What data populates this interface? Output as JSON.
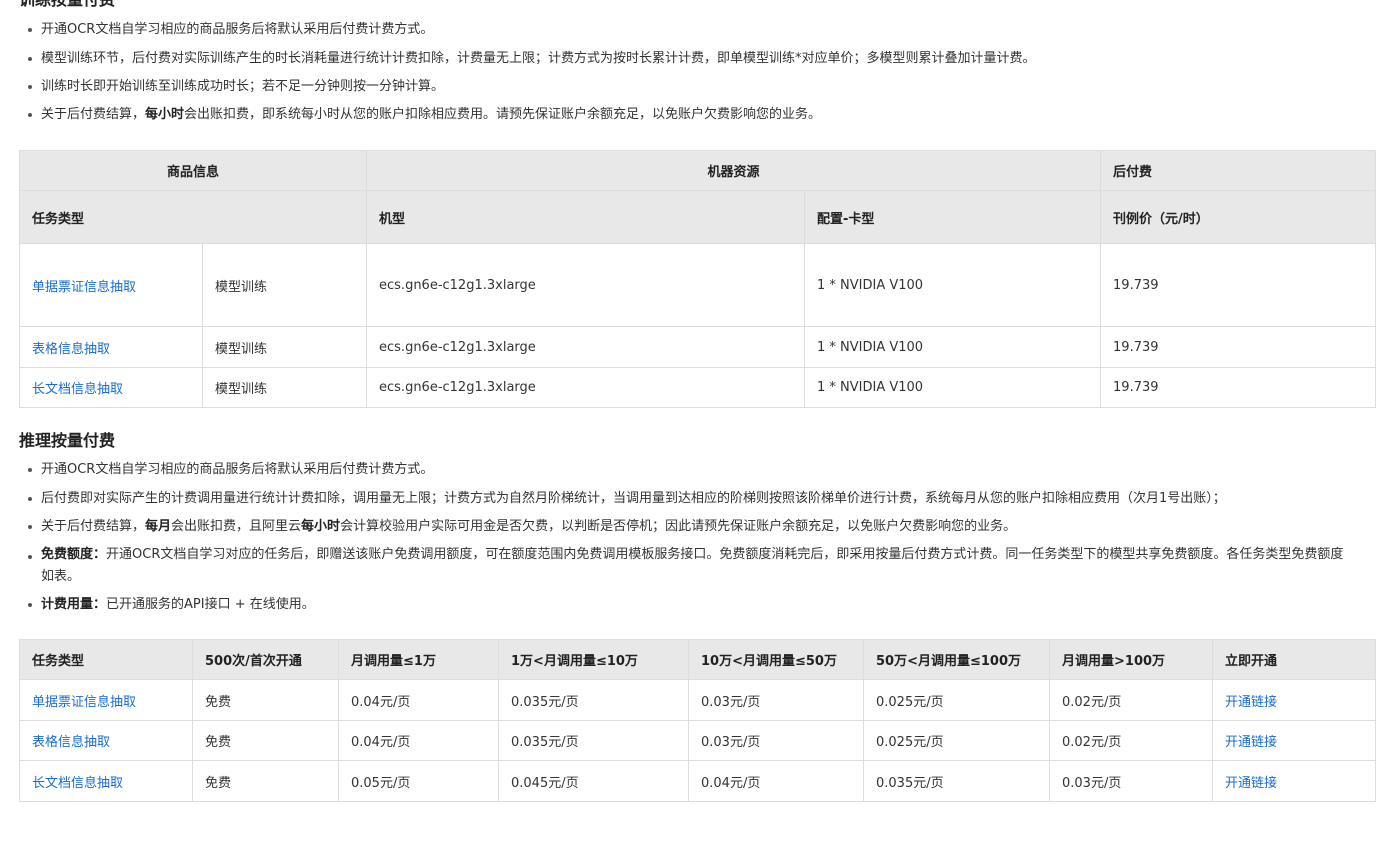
{
  "section1": {
    "title": "训练按量付费",
    "bullets": [
      {
        "pre": "开通OCR文档自学习相应的商品服务后将默认采用后付费计费方式。"
      },
      {
        "pre": "模型训练环节，后付费对实际训练产生的时长消耗量进行统计计费扣除，计费量无上限；计费方式为按时长累计计费，即单模型训练*对应单价；多模型则累计叠加计量计费。"
      },
      {
        "pre": "训练时长即开始训练至训练成功时长；若不足一分钟则按一分钟计算。"
      },
      {
        "pre": "关于后付费结算，",
        "bold1": "每小时",
        "post1": "会出账扣费，即系统每小时从您的账户扣除相应费用。请预先保证账户余额充足，以免账户欠费影响您的业务。"
      }
    ]
  },
  "table1": {
    "group_headers": [
      "商品信息",
      "机器资源",
      "后付费"
    ],
    "headers": [
      "任务类型",
      "机型",
      "配置-卡型",
      "刊例价（元/时）"
    ],
    "rows": [
      {
        "task": "单据票证信息抽取",
        "type": "模型训练",
        "machine": "ecs.gn6e-c12g1.3xlarge",
        "config": "1 * NVIDIA V100",
        "price": "19.739"
      },
      {
        "task": "表格信息抽取",
        "type": "模型训练",
        "machine": "ecs.gn6e-c12g1.3xlarge",
        "config": "1 * NVIDIA V100",
        "price": "19.739"
      },
      {
        "task": "长文档信息抽取",
        "type": "模型训练",
        "machine": "ecs.gn6e-c12g1.3xlarge",
        "config": "1 * NVIDIA V100",
        "price": "19.739"
      }
    ]
  },
  "section2": {
    "title": "推理按量付费",
    "bullets": [
      {
        "pre": "开通OCR文档自学习相应的商品服务后将默认采用后付费计费方式。"
      },
      {
        "pre": "后付费即对实际产生的计费调用量进行统计计费扣除，调用量无上限；计费方式为自然月阶梯统计，当调用量到达相应的阶梯则按照该阶梯单价进行计费，系统每月从您的账户扣除相应费用（次月1号出账）；"
      },
      {
        "pre": "关于后付费结算，",
        "bold1": "每月",
        "post1": "会出账扣费，且阿里云",
        "bold2": "每小时",
        "post2": "会计算校验用户实际可用金是否欠费，以判断是否停机；因此请预先保证账户余额充足，以免账户欠费影响您的业务。"
      },
      {
        "bold0": "免费额度：",
        "pre": "开通OCR文档自学习对应的任务后，即赠送该账户免费调用额度，可在额度范围内免费调用模板服务接口。免费额度消耗完后，即采用按量后付费方式计费。同一任务类型下的模型共享免费额度。各任务类型免费额度如表。"
      },
      {
        "bold0": "计费用量：",
        "pre": "已开通服务的API接口 + 在线使用。"
      }
    ]
  },
  "table2": {
    "headers": [
      "任务类型",
      "500次/首次开通",
      "月调用量≤1万",
      "1万<月调用量≤10万",
      "10万<月调用量≤50万",
      "50万<月调用量≤100万",
      "月调用量>100万",
      "立即开通"
    ],
    "rows": [
      {
        "task": "单据票证信息抽取",
        "free": "免费",
        "t1": "0.04元/页",
        "t2": "0.035元/页",
        "t3": "0.03元/页",
        "t4": "0.025元/页",
        "t5": "0.02元/页",
        "link": "开通链接"
      },
      {
        "task": "表格信息抽取",
        "free": "免费",
        "t1": "0.04元/页",
        "t2": "0.035元/页",
        "t3": "0.03元/页",
        "t4": "0.025元/页",
        "t5": "0.02元/页",
        "link": "开通链接"
      },
      {
        "task": "长文档信息抽取",
        "free": "免费",
        "t1": "0.05元/页",
        "t2": "0.045元/页",
        "t3": "0.04元/页",
        "t4": "0.035元/页",
        "t5": "0.03元/页",
        "link": "开通链接"
      }
    ]
  }
}
